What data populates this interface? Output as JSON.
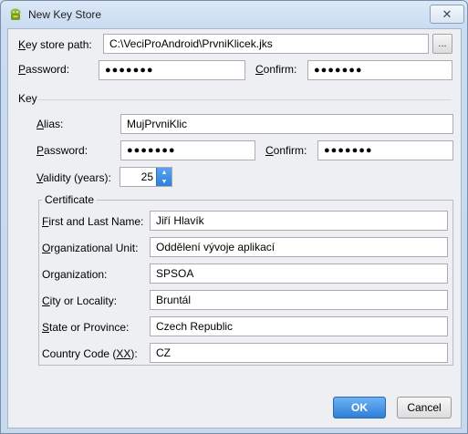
{
  "window": {
    "title": "New Key Store",
    "close_glyph": "✕"
  },
  "keystore": {
    "path_label_pre": "K",
    "path_label_post": "ey store path:",
    "path_value": "C:\\VeciProAndroid\\PrvniKlicek.jks",
    "browse_label": "...",
    "password_label_pre": "P",
    "password_label_post": "assword:",
    "password_value": "●●●●●●●",
    "confirm_label_pre": "C",
    "confirm_label_post": "onfirm:",
    "confirm_value": "●●●●●●●"
  },
  "key": {
    "section_label": "Key",
    "alias_label_pre": "A",
    "alias_label_post": "lias:",
    "alias_value": "MujPrvniKlic",
    "password_label_pre": "P",
    "password_label_post": "assword:",
    "password_value": "●●●●●●●",
    "confirm_label_pre": "C",
    "confirm_label_post": "onfirm:",
    "confirm_value": "●●●●●●●",
    "validity_label_pre": "V",
    "validity_label_post": "alidity (years):",
    "validity_value": "25"
  },
  "certificate": {
    "legend": "Certificate",
    "fields": [
      {
        "label_pre": "F",
        "label_post": "irst and Last Name:",
        "value": "Jiří Hlavík"
      },
      {
        "label_pre": "O",
        "label_post": "rganizational Unit:",
        "value": "Oddělení vývoje aplikací"
      },
      {
        "label_pre": "",
        "label_post": "Organization:",
        "value": "SPSOA"
      },
      {
        "label_pre": "C",
        "label_post": "ity or Locality:",
        "value": "Bruntál"
      },
      {
        "label_pre": "S",
        "label_post": "tate or Province:",
        "value": "Czech Republic"
      },
      {
        "label_pre": "",
        "label_post": "Country Code (",
        "value": "CZ"
      }
    ],
    "country_code_key": "XX",
    "country_code_close": "):"
  },
  "buttons": {
    "ok": "OK",
    "cancel": "Cancel"
  },
  "icons": {
    "app": "android-icon",
    "close": "close-icon",
    "spin_up": "chevron-up-icon",
    "spin_down": "chevron-down-icon"
  }
}
